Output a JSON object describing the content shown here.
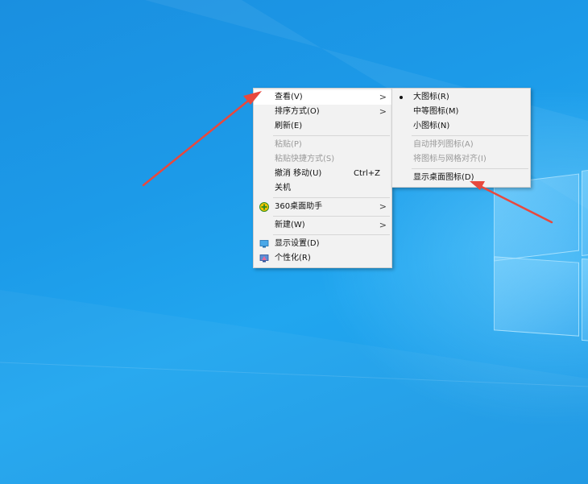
{
  "desktop": {
    "colors": {
      "background": "#1c9ae8",
      "annotation_arrow": "#e8483d"
    }
  },
  "context_menu": {
    "items": [
      {
        "label": "查看(V)",
        "submenu": true,
        "highlighted": true
      },
      {
        "label": "排序方式(O)",
        "submenu": true
      },
      {
        "label": "刷新(E)"
      },
      {
        "label": "粘贴(P)",
        "disabled": true
      },
      {
        "label": "粘贴快捷方式(S)",
        "disabled": true
      },
      {
        "label": "撤消 移动(U)",
        "shortcut": "Ctrl+Z"
      },
      {
        "label": "关机"
      },
      {
        "label": "360桌面助手",
        "submenu": true,
        "icon": "360-icon"
      },
      {
        "label": "新建(W)",
        "submenu": true
      },
      {
        "label": "显示设置(D)",
        "icon": "display-settings-icon"
      },
      {
        "label": "个性化(R)",
        "icon": "personalize-icon"
      }
    ]
  },
  "view_submenu": {
    "items": [
      {
        "label": "大图标(R)",
        "selected": true
      },
      {
        "label": "中等图标(M)"
      },
      {
        "label": "小图标(N)"
      },
      {
        "label": "自动排列图标(A)",
        "disabled": true
      },
      {
        "label": "将图标与网格对齐(I)",
        "disabled": true
      },
      {
        "label": "显示桌面图标(D)"
      }
    ]
  },
  "icons": {
    "submenu_arrow": ">"
  }
}
